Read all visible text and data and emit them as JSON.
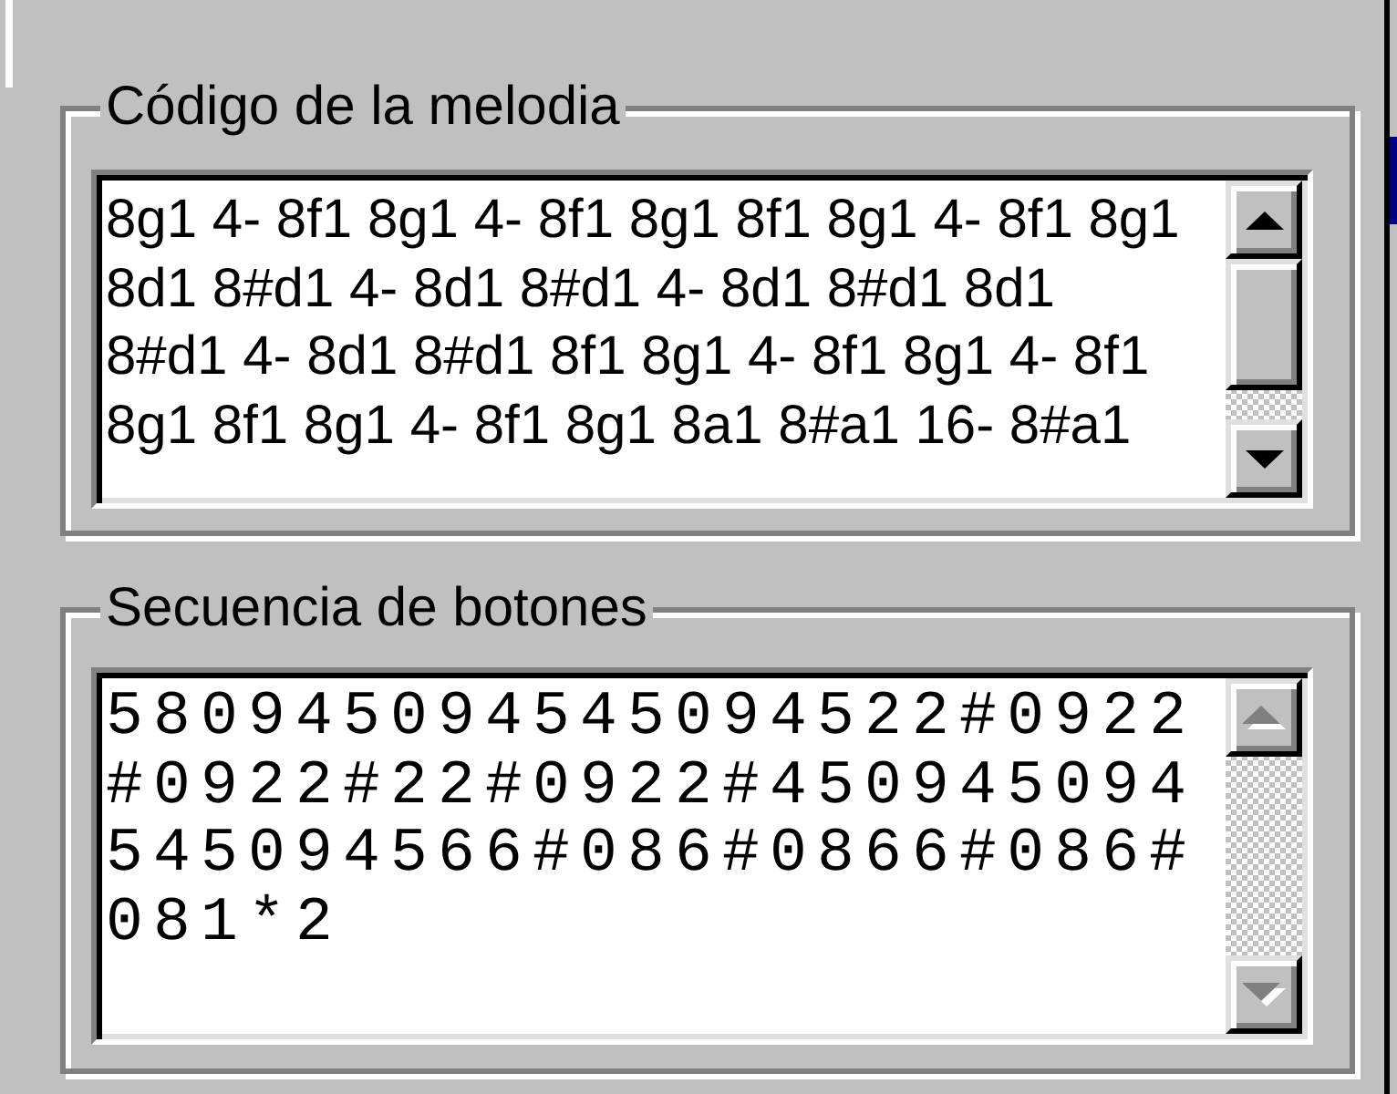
{
  "groups": [
    {
      "title": "Código de la melodia",
      "text_box": {
        "kind": "notes",
        "value": "8g1 4- 8f1 8g1 4- 8f1 8g1 8f1 8g1 4- 8f1 8g1\n8d1 8#d1 4- 8d1 8#d1 4- 8d1 8#d1 8d1\n8#d1 4- 8d1 8#d1 8f1 8g1 4- 8f1 8g1 4- 8f1\n8g1 8f1 8g1 4- 8f1 8g1 8a1 8#a1 16- 8#a1",
        "scrollbar_disabled": false
      }
    },
    {
      "title": "Secuencia de botones",
      "text_box": {
        "kind": "digits",
        "value": "580945094545094522#0922\n#0922#22#0922#450945094\n545094566#086#0866#086#\n081*2",
        "scrollbar_disabled": true
      }
    }
  ]
}
